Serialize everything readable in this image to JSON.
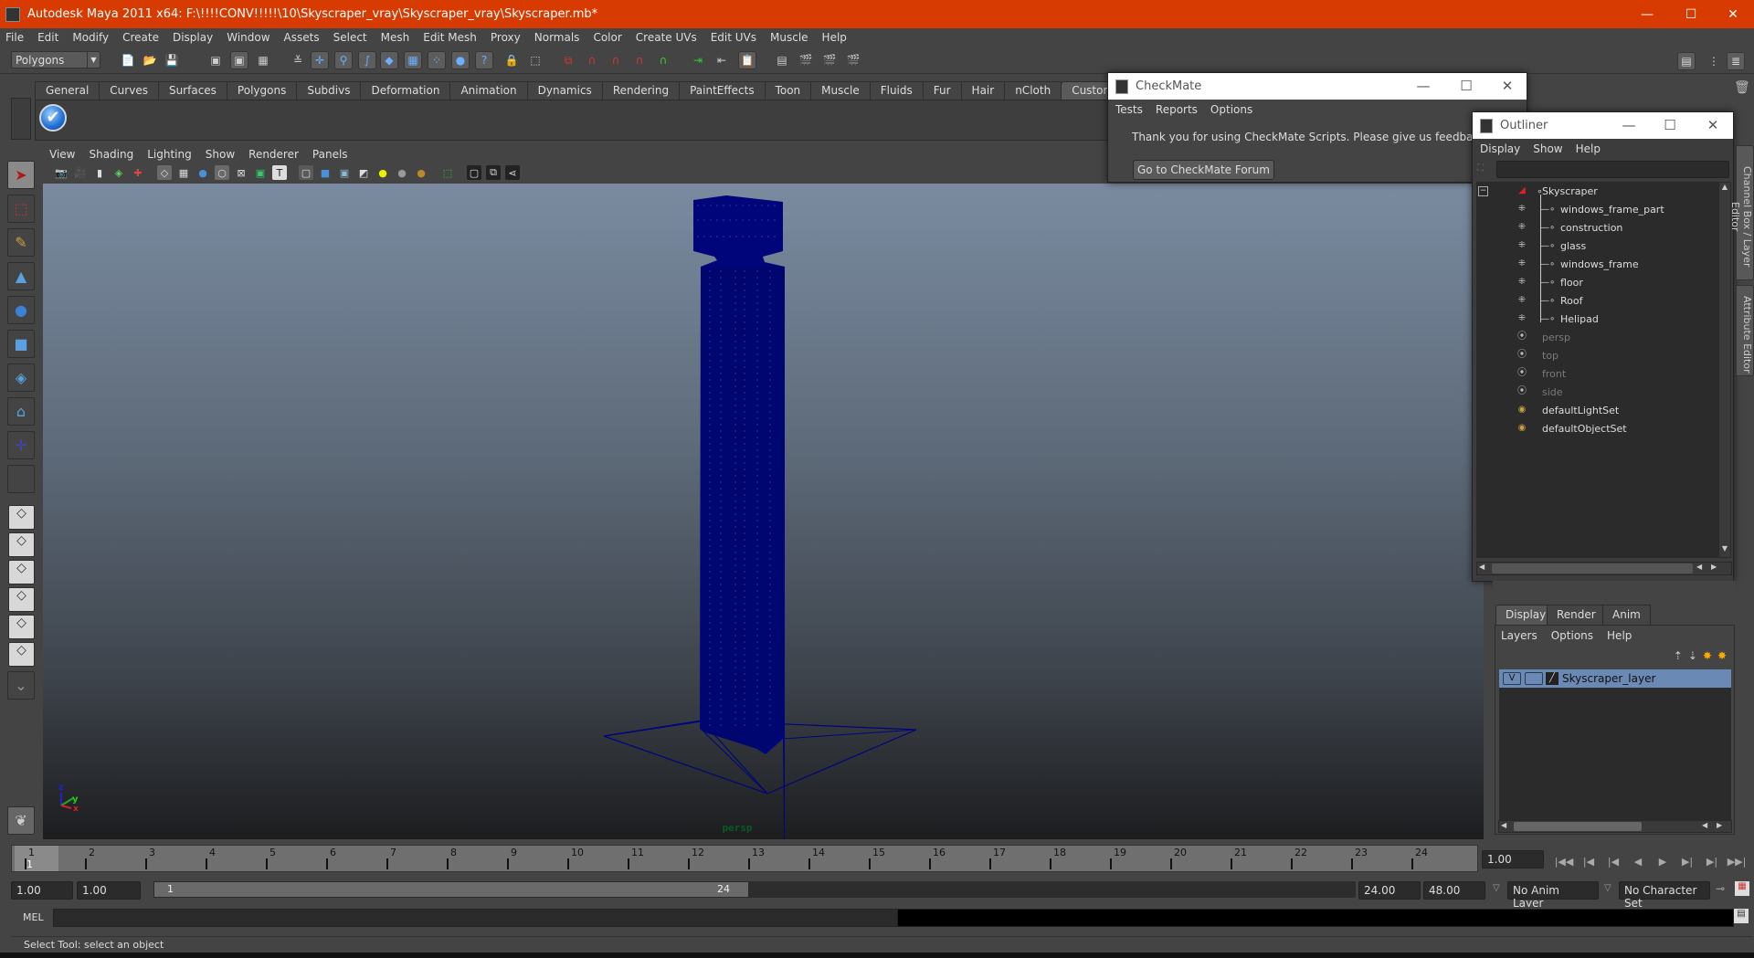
{
  "window": {
    "title": "Autodesk Maya 2011 x64: F:\\!!!!CONV!!!!!\\10\\Skyscraper_vray\\Skyscraper_vray\\Skyscraper.mb*",
    "controls": {
      "minimize": "—",
      "maximize": "☐",
      "close": "✕"
    }
  },
  "menubar": [
    "File",
    "Edit",
    "Modify",
    "Create",
    "Display",
    "Window",
    "Assets",
    "Select",
    "Mesh",
    "Edit Mesh",
    "Proxy",
    "Normals",
    "Color",
    "Create UVs",
    "Edit UVs",
    "Muscle",
    "Help"
  ],
  "statusline": {
    "mode_selector": "Polygons",
    "icons": [
      "new-scene-icon",
      "open-scene-icon",
      "save-scene-icon",
      "select-by-hierarchy-icon",
      "select-by-object-icon",
      "select-by-component-icon",
      "filter-icon",
      "select-handles-icon",
      "select-joints-icon",
      "select-curves-icon",
      "select-surfaces-icon",
      "select-deformations-icon",
      "select-dynamics-icon",
      "select-rendering-icon",
      "select-misc-icon",
      "lock-selection-icon",
      "highlight-selection-icon",
      "snap-grid-icon",
      "snap-curve-icon",
      "snap-point-icon",
      "snap-view-plane-icon",
      "snap-live-icon",
      "input-ops-icon",
      "output-ops-icon",
      "construction-history-icon",
      "render-view-icon",
      "render-icon",
      "ipr-render-icon",
      "render-settings-icon"
    ]
  },
  "shelf": {
    "tabs": [
      "General",
      "Curves",
      "Surfaces",
      "Polygons",
      "Subdivs",
      "Deformation",
      "Animation",
      "Dynamics",
      "Rendering",
      "PaintEffects",
      "Toon",
      "Muscle",
      "Fluids",
      "Fur",
      "Hair",
      "nCloth",
      "Custom"
    ],
    "active_tab": "Custom",
    "buttons": [
      {
        "icon": "checkmate-check-icon",
        "glyph": "✔"
      }
    ]
  },
  "toolbox": {
    "tools": [
      {
        "name": "select-tool",
        "glyph": "➤",
        "color": "#b01818"
      },
      {
        "name": "lasso-tool",
        "glyph": "⬚",
        "color": "#c33"
      },
      {
        "name": "paint-select-tool",
        "glyph": "✎",
        "color": "#c8a040"
      },
      {
        "name": "move-tool",
        "glyph": "▲",
        "color": "#5aa0e0"
      },
      {
        "name": "rotate-tool",
        "glyph": "●",
        "color": "#3b82d6"
      },
      {
        "name": "scale-tool",
        "glyph": "■",
        "color": "#5aa0e0"
      },
      {
        "name": "universal-manipulator-tool",
        "glyph": "◈",
        "color": "#5aa0e0"
      },
      {
        "name": "soft-mod-tool",
        "glyph": "⌂",
        "color": "#5aa0e0"
      },
      {
        "name": "show-manipulator-tool",
        "glyph": "✛",
        "color": "#44b"
      },
      {
        "name": "last-tool-slot",
        "glyph": "",
        "color": "#444"
      }
    ],
    "layout_icons": [
      "single-perspective-layout-icon",
      "four-view-layout-icon",
      "outliner-persp-layout-icon",
      "persp-graph-layout-icon",
      "hypershade-persp-layout-icon",
      "persp-graph-hypergraph-layout-icon"
    ]
  },
  "panel": {
    "menu": [
      "View",
      "Shading",
      "Lighting",
      "Show",
      "Renderer",
      "Panels"
    ],
    "camera_label": "persp",
    "axis": {
      "x": "x",
      "y": "y",
      "z": "z"
    },
    "wire_color": "#00047a"
  },
  "checkmate": {
    "title": "CheckMate",
    "menu": [
      "Tests",
      "Reports",
      "Options"
    ],
    "message": "Thank you for using CheckMate Scripts. Please give us feedback at the CheckMate Forum",
    "button": "Go to CheckMate Forum"
  },
  "outliner": {
    "title": "Outliner",
    "menu": [
      "Display",
      "Show",
      "Help"
    ],
    "filter_value": "",
    "items": [
      {
        "label": "Skyscraper",
        "icon": "transform-group-icon",
        "level": 0,
        "dim": false
      },
      {
        "label": "windows_frame_part",
        "icon": "mesh-icon",
        "level": 1,
        "dim": false
      },
      {
        "label": "construction",
        "icon": "mesh-icon",
        "level": 1,
        "dim": false
      },
      {
        "label": "glass",
        "icon": "mesh-icon",
        "level": 1,
        "dim": false
      },
      {
        "label": "windows_frame",
        "icon": "mesh-icon",
        "level": 1,
        "dim": false
      },
      {
        "label": "floor",
        "icon": "mesh-icon",
        "level": 1,
        "dim": false
      },
      {
        "label": "Roof",
        "icon": "mesh-icon",
        "level": 1,
        "dim": false
      },
      {
        "label": "Helipad",
        "icon": "mesh-icon",
        "level": 1,
        "dim": false
      },
      {
        "label": "persp",
        "icon": "camera-icon",
        "level": 0,
        "dim": true
      },
      {
        "label": "top",
        "icon": "camera-icon",
        "level": 0,
        "dim": true
      },
      {
        "label": "front",
        "icon": "camera-icon",
        "level": 0,
        "dim": true
      },
      {
        "label": "side",
        "icon": "camera-icon",
        "level": 0,
        "dim": true
      },
      {
        "label": "defaultLightSet",
        "icon": "set-icon",
        "level": 0,
        "dim": false
      },
      {
        "label": "defaultObjectSet",
        "icon": "set-icon",
        "level": 0,
        "dim": false
      }
    ]
  },
  "side_tabs": [
    "Channel Box / Layer Editor",
    "Attribute Editor"
  ],
  "layer_editor": {
    "tabs": [
      "Display",
      "Render",
      "Anim"
    ],
    "active_tab": "Display",
    "menu": [
      "Layers",
      "Options",
      "Help"
    ],
    "layers": [
      {
        "name": "Skyscraper_layer",
        "visible": "V",
        "selected": true
      }
    ]
  },
  "timeline": {
    "ticks": [
      "1",
      "2",
      "3",
      "4",
      "5",
      "6",
      "7",
      "8",
      "9",
      "10",
      "11",
      "12",
      "13",
      "14",
      "15",
      "16",
      "17",
      "18",
      "19",
      "20",
      "21",
      "22",
      "23",
      "24"
    ],
    "current_frame_marker": "1",
    "current_frame": "1.00",
    "playback": [
      "go-to-start-icon",
      "step-back-key-icon",
      "step-back-frame-icon",
      "play-backwards-icon",
      "play-forwards-icon",
      "step-forward-frame-icon",
      "step-forward-key-icon",
      "go-to-end-icon"
    ]
  },
  "range": {
    "start_time": "1.00",
    "playback_start": "1.00",
    "slider_start": "1",
    "slider_end": "24",
    "playback_end": "24.00",
    "end_time": "48.00",
    "anim_layer": "No Anim Layer",
    "character_set": "No Character Set"
  },
  "command": {
    "label": "MEL",
    "input": "",
    "result": ""
  },
  "status": {
    "help_line": "Select Tool: select an object"
  }
}
